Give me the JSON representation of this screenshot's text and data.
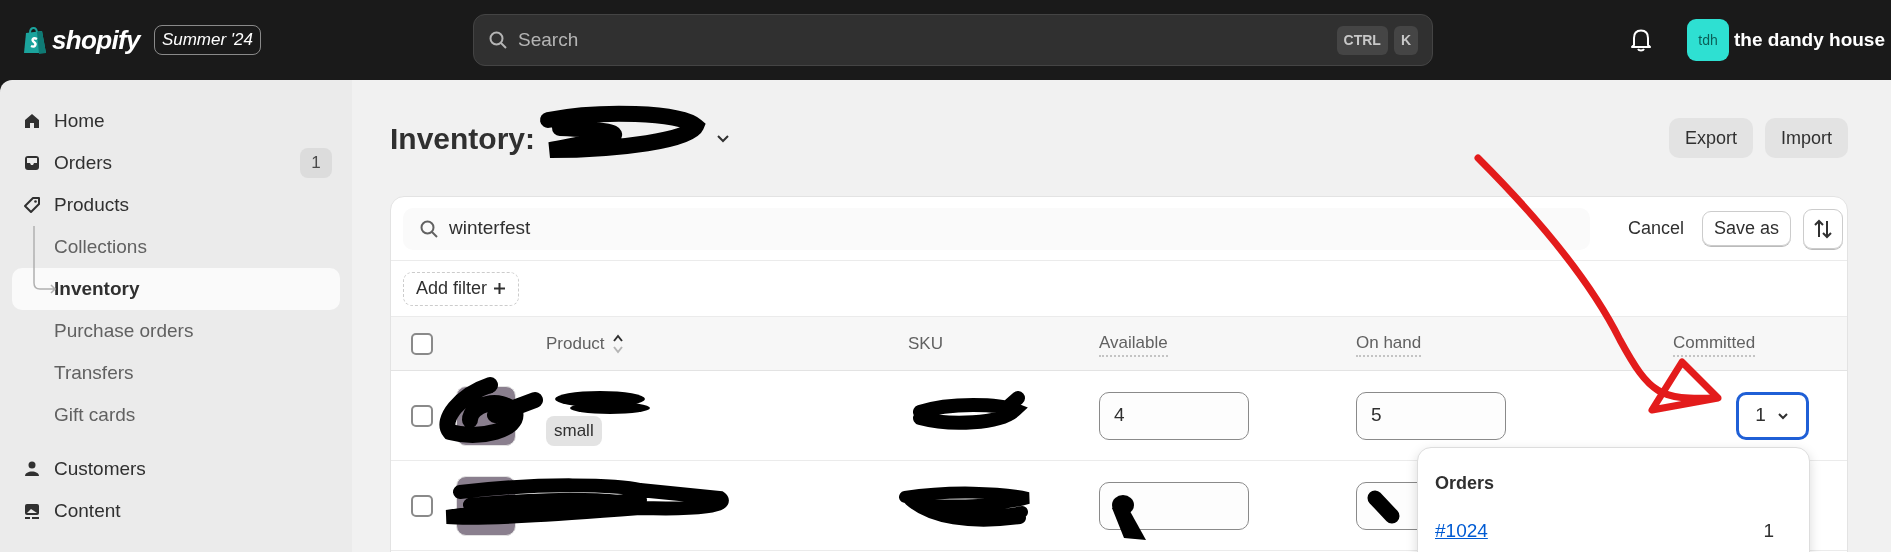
{
  "topbar": {
    "logo": "shopify",
    "edition": "Summer '24",
    "search": {
      "placeholder": "Search",
      "shortcut": [
        "CTRL",
        "K"
      ]
    },
    "store": {
      "avatar": "tdh",
      "name": "the dandy house"
    }
  },
  "sidebar": {
    "items": [
      {
        "label": "Home",
        "kind": "home",
        "selected": false
      },
      {
        "label": "Orders",
        "kind": "orders",
        "badge": "1",
        "selected": false
      },
      {
        "label": "Products",
        "kind": "products",
        "selected": false,
        "children": [
          {
            "label": "Collections",
            "selected": false
          },
          {
            "label": "Inventory",
            "selected": true
          },
          {
            "label": "Purchase orders",
            "selected": false
          },
          {
            "label": "Transfers",
            "selected": false
          },
          {
            "label": "Gift cards",
            "selected": false
          }
        ]
      },
      {
        "label": "Customers",
        "kind": "customers",
        "selected": false
      },
      {
        "label": "Content",
        "kind": "content",
        "selected": false
      }
    ]
  },
  "page": {
    "title": "Inventory:",
    "actions": [
      "Export",
      "Import"
    ]
  },
  "card": {
    "search": {
      "value": "winterfest"
    },
    "cancel": "Cancel",
    "save": "Save as",
    "add_filter": "Add filter",
    "select_all": {
      "checked": false
    },
    "columns": [
      {
        "label": "Product",
        "kind": "sort"
      },
      {
        "label": "SKU",
        "kind": "plain"
      },
      {
        "label": "Available",
        "kind": "dotted"
      },
      {
        "label": "On hand",
        "kind": "dotted"
      },
      {
        "label": "Committed",
        "kind": "dotted"
      }
    ],
    "rows": [
      {
        "checked": false,
        "tag": "small",
        "available": "4",
        "on_hand": "5",
        "committed": "1",
        "committed_open": true
      },
      {
        "checked": false
      }
    ]
  },
  "popover": {
    "title": "Orders",
    "orders": [
      {
        "number": "#1024",
        "quantity": "1"
      }
    ]
  }
}
